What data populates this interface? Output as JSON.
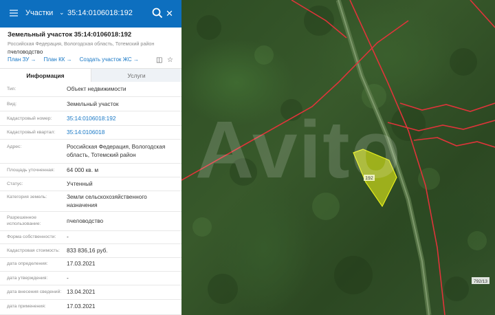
{
  "search": {
    "layer": "Участки",
    "query": "35:14:0106018:192"
  },
  "parcel": {
    "title": "Земельный участок 35:14:0106018:192",
    "address_line": "Российская Федерация, Вологодская область, Тотемский район",
    "use": "пчеловодство"
  },
  "links": [
    "План ЗУ →",
    "План КК →",
    "Создать участок ЖС →"
  ],
  "tabs": [
    "Информация",
    "Услуги"
  ],
  "rows": [
    {
      "label": "Тип:",
      "value": "Объект недвижимости"
    },
    {
      "label": "Вид:",
      "value": "Земельный участок"
    },
    {
      "label": "Кадастровый номер:",
      "value": "35:14:0106018:192"
    },
    {
      "label": "Кадастровый квартал:",
      "value": "35:14:0106018"
    },
    {
      "label": "Адрес:",
      "value": "Российская Федерация, Вологодская область, Тотемский район"
    },
    {
      "label": "Площадь уточненная:",
      "value": "64 000 кв. м"
    },
    {
      "label": "Статус:",
      "value": "Учтенный"
    },
    {
      "label": "Категория земель:",
      "value": "Земли сельскохозяйственного назначения"
    },
    {
      "label": "Разрешенное использование:",
      "value": "пчеловодство"
    },
    {
      "label": "Форма собственности:",
      "value": "-"
    },
    {
      "label": "Кадастровая стоимость:",
      "value": "833 836,16 руб."
    },
    {
      "label": "дата определения:",
      "value": "17.03.2021"
    },
    {
      "label": "дата утверждения:",
      "value": "-"
    },
    {
      "label": "дата внесения сведений:",
      "value": "13.04.2021"
    },
    {
      "label": "дата применения:",
      "value": "17.03.2021"
    }
  ],
  "map": {
    "parcel_label": "192",
    "sheet_label": "792/13",
    "watermark": "Avito"
  },
  "colors": {
    "brand": "#0d6fbf",
    "link": "#1777c5",
    "parcel_fill": "#c8d619",
    "boundary": "#e0343a"
  }
}
